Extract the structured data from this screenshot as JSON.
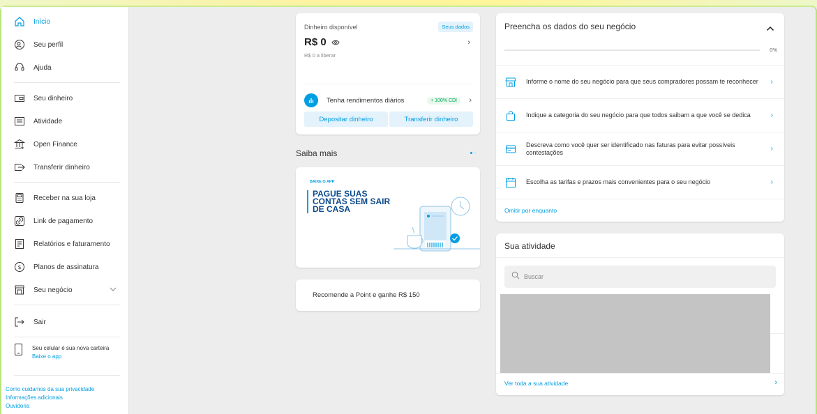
{
  "sidebar": {
    "items": [
      {
        "label": "Início",
        "icon": "home-icon",
        "active": true
      },
      {
        "label": "Seu perfil",
        "icon": "profile-icon"
      },
      {
        "label": "Ajuda",
        "icon": "help-icon"
      },
      {
        "label": "Seu dinheiro",
        "icon": "wallet-icon"
      },
      {
        "label": "Atividade",
        "icon": "activity-icon"
      },
      {
        "label": "Open Finance",
        "icon": "bank-icon"
      },
      {
        "label": "Transferir dinheiro",
        "icon": "transfer-icon"
      },
      {
        "label": "Receber na sua loja",
        "icon": "pos-icon"
      },
      {
        "label": "Link de pagamento",
        "icon": "link-icon"
      },
      {
        "label": "Relatórios e faturamento",
        "icon": "report-icon"
      },
      {
        "label": "Planos de assinatura",
        "icon": "subscription-icon"
      },
      {
        "label": "Seu negócio",
        "icon": "store-icon"
      },
      {
        "label": "Sair",
        "icon": "logout-icon"
      }
    ],
    "promo": {
      "text": "Seu celular é sua nova carteira",
      "link": "Baixe o app"
    },
    "footer_links": [
      "Como cuidamos da sua privacidade",
      "Informações adicionais",
      "Ouvidoria"
    ]
  },
  "balance": {
    "title": "Dinheiro disponível",
    "badge": "Seus dados",
    "amount": "R$ 0",
    "sub": "R$ 0 a liberar",
    "yield_text": "Tenha rendimentos diários",
    "yield_badge": "+ 100% CDI",
    "deposit_label": "Depositar dinheiro",
    "transfer_label": "Transferir dinheiro"
  },
  "saiba_mais": {
    "title": "Saiba mais",
    "promo_kicker": "BAIXE O APP",
    "promo_headline": "PAGUE SUAS CONTAS SEM SAIR DE CASA",
    "recommend": "Recomende a Point e ganhe R$ 150"
  },
  "setup": {
    "title": "Preencha os dados do seu negócio",
    "progress_percent": "0%",
    "steps": [
      {
        "text": "Informe o nome do seu negócio para que seus compradores possam te reconhecer",
        "icon": "store-icon"
      },
      {
        "text": "Indique a categoria do seu negócio para que todos saibam a que você se dedica",
        "icon": "bag-icon"
      },
      {
        "text": "Descreva como você quer ser identificado nas faturas para evitar possíveis contestações",
        "icon": "card-icon"
      },
      {
        "text": "Escolha as tarifas e prazos mais convenientes para o seu negócio",
        "icon": "calendar-icon"
      }
    ],
    "omit_label": "Omitir por enquanto"
  },
  "activity": {
    "title": "Sua atividade",
    "search_placeholder": "Buscar",
    "footer_link": "Ver toda a sua atividade"
  },
  "colors": {
    "accent": "#009ee3",
    "frame": "#b8e37a"
  }
}
